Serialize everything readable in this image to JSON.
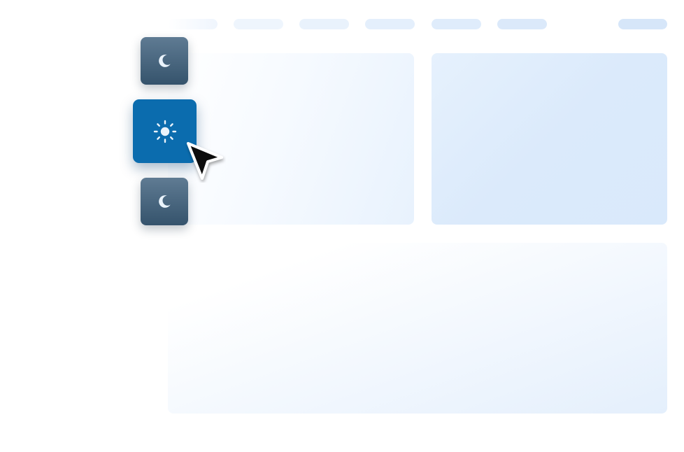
{
  "colors": {
    "light_button": "#0b6cae",
    "dark_button_top": "#5f7b93",
    "dark_button_bottom": "#35536c",
    "icon_fill": "#eaf3fb",
    "placeholder_tint": "#e4effc"
  },
  "theme_switcher": {
    "options": [
      {
        "mode": "dark",
        "icon": "moon-icon",
        "selected": false
      },
      {
        "mode": "light",
        "icon": "sun-icon",
        "selected": true
      },
      {
        "mode": "dark",
        "icon": "moon-icon",
        "selected": false
      }
    ]
  },
  "cursor": {
    "icon": "arrow-cursor-icon"
  },
  "backdrop": {
    "nav_placeholder_count": 7,
    "panel_placeholder_count": 3
  }
}
